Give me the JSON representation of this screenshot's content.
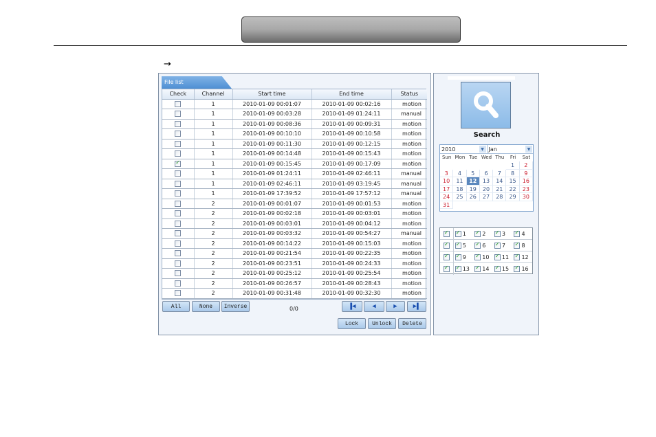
{
  "page": {
    "title_bar_text": "",
    "arrow_symbol": "→"
  },
  "file_list": {
    "tab_label": "File list",
    "columns": [
      "Check",
      "Channel",
      "Start time",
      "End time",
      "Status"
    ],
    "rows": [
      {
        "checked": false,
        "channel": "1",
        "start": "2010-01-09 00:01:07",
        "end": "2010-01-09 00:02:16",
        "status": "motion"
      },
      {
        "checked": false,
        "channel": "1",
        "start": "2010-01-09 00:03:28",
        "end": "2010-01-09 01:24:11",
        "status": "manual"
      },
      {
        "checked": false,
        "channel": "1",
        "start": "2010-01-09 00:08:36",
        "end": "2010-01-09 00:09:31",
        "status": "motion"
      },
      {
        "checked": false,
        "channel": "1",
        "start": "2010-01-09 00:10:10",
        "end": "2010-01-09 00:10:58",
        "status": "motion"
      },
      {
        "checked": false,
        "channel": "1",
        "start": "2010-01-09 00:11:30",
        "end": "2010-01-09 00:12:15",
        "status": "motion"
      },
      {
        "checked": false,
        "channel": "1",
        "start": "2010-01-09 00:14:48",
        "end": "2010-01-09 00:15:43",
        "status": "motion"
      },
      {
        "checked": true,
        "channel": "1",
        "start": "2010-01-09 00:15:45",
        "end": "2010-01-09 00:17:09",
        "status": "motion"
      },
      {
        "checked": false,
        "channel": "1",
        "start": "2010-01-09 01:24:11",
        "end": "2010-01-09 02:46:11",
        "status": "manual"
      },
      {
        "checked": false,
        "channel": "1",
        "start": "2010-01-09 02:46:11",
        "end": "2010-01-09 03:19:45",
        "status": "manual"
      },
      {
        "checked": false,
        "channel": "1",
        "start": "2010-01-09 17:39:52",
        "end": "2010-01-09 17:57:12",
        "status": "manual"
      },
      {
        "checked": false,
        "channel": "2",
        "start": "2010-01-09 00:01:07",
        "end": "2010-01-09 00:01:53",
        "status": "motion"
      },
      {
        "checked": false,
        "channel": "2",
        "start": "2010-01-09 00:02:18",
        "end": "2010-01-09 00:03:01",
        "status": "motion"
      },
      {
        "checked": false,
        "channel": "2",
        "start": "2010-01-09 00:03:01",
        "end": "2010-01-09 00:04:12",
        "status": "motion"
      },
      {
        "checked": false,
        "channel": "2",
        "start": "2010-01-09 00:03:32",
        "end": "2010-01-09 00:54:27",
        "status": "manual"
      },
      {
        "checked": false,
        "channel": "2",
        "start": "2010-01-09 00:14:22",
        "end": "2010-01-09 00:15:03",
        "status": "motion"
      },
      {
        "checked": false,
        "channel": "2",
        "start": "2010-01-09 00:21:54",
        "end": "2010-01-09 00:22:35",
        "status": "motion"
      },
      {
        "checked": false,
        "channel": "2",
        "start": "2010-01-09 00:23:51",
        "end": "2010-01-09 00:24:33",
        "status": "motion"
      },
      {
        "checked": false,
        "channel": "2",
        "start": "2010-01-09 00:25:12",
        "end": "2010-01-09 00:25:54",
        "status": "motion"
      },
      {
        "checked": false,
        "channel": "2",
        "start": "2010-01-09 00:26:57",
        "end": "2010-01-09 00:28:43",
        "status": "motion"
      },
      {
        "checked": false,
        "channel": "2",
        "start": "2010-01-09 00:31:48",
        "end": "2010-01-09 00:32:30",
        "status": "motion"
      }
    ],
    "buttons": {
      "all": "All",
      "none": "None",
      "inverse": "Inverse",
      "lock": "Lock",
      "unlock": "Unlock",
      "delete": "Delete"
    },
    "page_info": "0/0",
    "nav_icons": {
      "first": "▐◀",
      "prev": "◀",
      "next": "▶",
      "last": "▶▌"
    }
  },
  "search": {
    "label": "Search",
    "icon": "magnifier-icon"
  },
  "calendar": {
    "year": "2010",
    "month": "Jan",
    "weekdays": [
      "Sun",
      "Mon",
      "Tue",
      "Wed",
      "Thu",
      "Fri",
      "Sat"
    ],
    "first_weekday_index": 5,
    "days_in_month": 31,
    "selected_day": 12
  },
  "channels": {
    "rows": [
      [
        "1",
        "2",
        "3",
        "4"
      ],
      [
        "5",
        "6",
        "7",
        "8"
      ],
      [
        "9",
        "10",
        "11",
        "12"
      ],
      [
        "13",
        "14",
        "15",
        "16"
      ]
    ],
    "all_checked": true
  }
}
